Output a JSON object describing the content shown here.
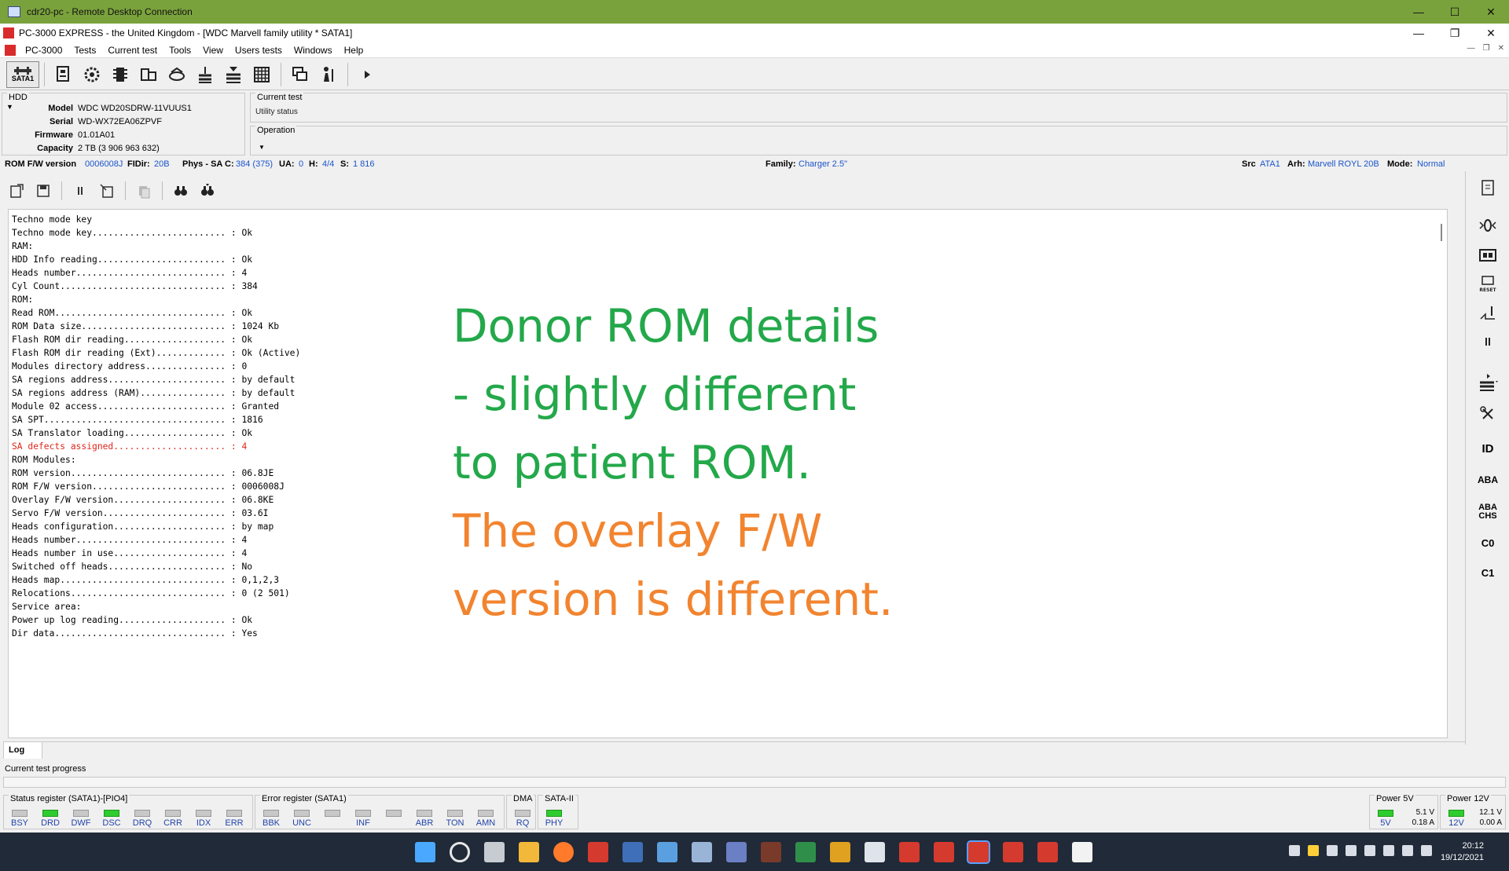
{
  "rdp_window": {
    "title": "cdr20-pc - Remote Desktop Connection"
  },
  "app_window": {
    "title": "PC-3000 EXPRESS - the United Kingdom - [WDC Marvell family utility * SATA1]"
  },
  "menu": {
    "items": [
      "PC-3000",
      "Tests",
      "Current test",
      "Tools",
      "View",
      "Users tests",
      "Windows",
      "Help"
    ]
  },
  "toolbar": {
    "sata_label": "SATA1",
    "buttons": [
      "hdd-info-icon",
      "settings-gear-icon",
      "chip-icon",
      "drive-icon",
      "disk-icon",
      "stack-icon",
      "drive-stack-icon",
      "grid-icon",
      "windows-icon",
      "person-icon",
      "play-icon"
    ]
  },
  "hdd": {
    "group_title": "HDD",
    "rows": [
      {
        "k": "Model",
        "v": "WDC WD20SDRW-11VUUS1"
      },
      {
        "k": "Serial",
        "v": "WD-WX72EA06ZPVF"
      },
      {
        "k": "Firmware",
        "v": "01.01A01"
      },
      {
        "k": "Capacity",
        "v": "2 TB (3 906 963 632)"
      }
    ]
  },
  "current_test": {
    "title": "Current test",
    "status": "Utility status"
  },
  "operation": {
    "title": "Operation"
  },
  "info_strip": {
    "rom_fw_label": "ROM F/W version",
    "rom_fw_value": "0006008J",
    "fidir_label": "FIDir:",
    "fidir_value": "20B",
    "phys_label": "Phys - SA C:",
    "phys_value": "384 (375)",
    "ua_label": "UA:",
    "ua_value": "0",
    "h_label": "H:",
    "h_value": "4/4",
    "s_label": "S:",
    "s_value": "1 816",
    "family_label": "Family:",
    "family_value": "Charger 2.5\"",
    "src_label": "Src",
    "src_value": "ATA1",
    "arh_label": "Arh:",
    "arh_value": "Marvell ROYL 20B",
    "mode_label": "Mode:",
    "mode_value": "Normal"
  },
  "log": {
    "tab_label": "Log",
    "lines": [
      {
        "t": "Techno mode key"
      },
      {
        "t": "Techno mode key......................... : Ok"
      },
      {
        "t": ""
      },
      {
        "t": "RAM:"
      },
      {
        "t": "HDD Info reading........................ : Ok"
      },
      {
        "t": "Heads number............................ : 4"
      },
      {
        "t": "Cyl Count............................... : 384"
      },
      {
        "t": "ROM:"
      },
      {
        "t": "Read ROM................................ : Ok"
      },
      {
        "t": "ROM Data size........................... : 1024 Kb"
      },
      {
        "t": "Flash ROM dir reading................... : Ok"
      },
      {
        "t": "Flash ROM dir reading (Ext)............. : Ok (Active)"
      },
      {
        "t": "Modules directory address............... : 0"
      },
      {
        "t": "SA regions address...................... : by default"
      },
      {
        "t": "SA regions address (RAM)................ : by default"
      },
      {
        "t": "Module 02 access........................ : Granted"
      },
      {
        "t": ""
      },
      {
        "t": "SA SPT.................................. : 1816"
      },
      {
        "t": ""
      },
      {
        "t": "SA Translator loading................... : Ok"
      },
      {
        "t": "SA defects assigned..................... : 4",
        "err": true
      },
      {
        "t": ""
      },
      {
        "t": "ROM Modules:"
      },
      {
        "t": "ROM version............................. : 06.8JE"
      },
      {
        "t": "ROM F/W version......................... : 0006008J"
      },
      {
        "t": "Overlay F/W version..................... : 06.8KE"
      },
      {
        "t": "Servo F/W version....................... : 03.6I"
      },
      {
        "t": ""
      },
      {
        "t": "Heads configuration..................... : by map"
      },
      {
        "t": "Heads number............................ : 4"
      },
      {
        "t": "Heads number in use..................... : 4"
      },
      {
        "t": "Switched off heads...................... : No"
      },
      {
        "t": "Heads map............................... : 0,1,2,3"
      },
      {
        "t": ""
      },
      {
        "t": "Relocations............................. : 0 (2 501)"
      },
      {
        "t": ""
      },
      {
        "t": "Service area:"
      },
      {
        "t": "Power up log reading.................... : Ok"
      },
      {
        "t": "Dir data................................ : Yes"
      }
    ]
  },
  "annotation": {
    "line1": "Donor ROM details",
    "line2": "- slightly different",
    "line3": "to patient ROM.",
    "line4": "The overlay F/W",
    "line5": "version is different.",
    "green": "#23a84a",
    "orange": "#f2842f"
  },
  "right_sidebar": {
    "labels": {
      "id": "ID",
      "aba": "ABA",
      "aba_chs_top": "ABA",
      "aba_chs_bottom": "CHS",
      "c0": "C0",
      "c1": "C1"
    }
  },
  "progress": {
    "label": "Current test progress"
  },
  "registers": {
    "status": {
      "title": "Status register (SATA1)-[PIO4]",
      "leds": [
        {
          "n": "BSY",
          "on": false
        },
        {
          "n": "DRD",
          "on": true
        },
        {
          "n": "DWF",
          "on": false
        },
        {
          "n": "DSC",
          "on": true
        },
        {
          "n": "DRQ",
          "on": false
        },
        {
          "n": "CRR",
          "on": false
        },
        {
          "n": "IDX",
          "on": false
        },
        {
          "n": "ERR",
          "on": false
        }
      ]
    },
    "error": {
      "title": "Error register (SATA1)",
      "leds": [
        {
          "n": "BBK",
          "on": false
        },
        {
          "n": "UNC",
          "on": false
        },
        {
          "n": "",
          "on": false
        },
        {
          "n": "INF",
          "on": false
        },
        {
          "n": "",
          "on": false
        },
        {
          "n": "ABR",
          "on": false
        },
        {
          "n": "TON",
          "on": false
        },
        {
          "n": "AMN",
          "on": false
        }
      ]
    },
    "dma": {
      "title": "DMA",
      "leds": [
        {
          "n": "RQ",
          "on": false
        }
      ]
    },
    "sata2": {
      "title": "SATA-II",
      "leds": [
        {
          "n": "PHY",
          "on": true
        }
      ]
    },
    "power5": {
      "title": "Power 5V",
      "led": "5V",
      "volt": "5.1 V",
      "amp": "0.18 A"
    },
    "power12": {
      "title": "Power 12V",
      "led": "12V",
      "volt": "12.1 V",
      "amp": "0.00 A"
    }
  },
  "taskbar": {
    "time": "20:12",
    "date": "19/12/2021"
  }
}
